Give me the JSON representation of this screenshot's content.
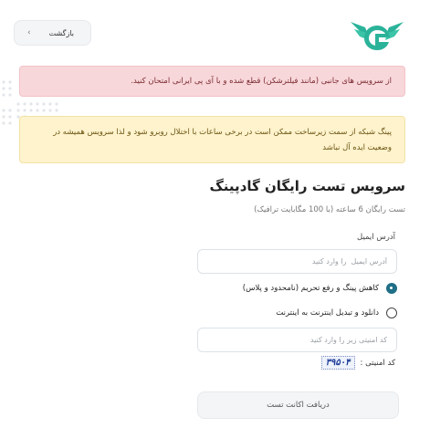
{
  "header": {
    "back_label": "بازگشت"
  },
  "alerts": {
    "red": "از سرویس های جانبی (مانند فیلترشکن) قطع شده و با آی پی ایرانی امتحان کنید.",
    "yellow": "پینگ شبکه از سمت زیرساخت ممکن است در برخی ساعات با اختلال روبرو شود و لذا سرویس همیشه در وضعیت ایده آل نباشد"
  },
  "form": {
    "title": "سرویس تست رایگان گادپینگ",
    "subtitle": "تست رایگان 6 ساعته (با 100 مگابایت ترافیک)",
    "email_label": "آدرس ایمیل",
    "email_placeholder": "آدرس ایمیل  را وارد کنید",
    "options": [
      {
        "label": "کاهش پینگ و رفع تحریم (نامحدود و پلاس)",
        "checked": true
      },
      {
        "label": "دانلود و تبدیل اینترنت به اینترنت",
        "checked": false
      }
    ],
    "captcha_placeholder": "کد امنیتی زیر را وارد کنید",
    "captcha_label": "کد امنیتی :",
    "captcha_code": "۳۹۵۰۴",
    "submit_label": "دریافت اکانت تست"
  },
  "colors": {
    "brand": "#2bb39a",
    "radio_checked": "#1f6f86",
    "alert_red_bg": "#f8d7da",
    "alert_yellow_bg": "#fff3cd"
  }
}
